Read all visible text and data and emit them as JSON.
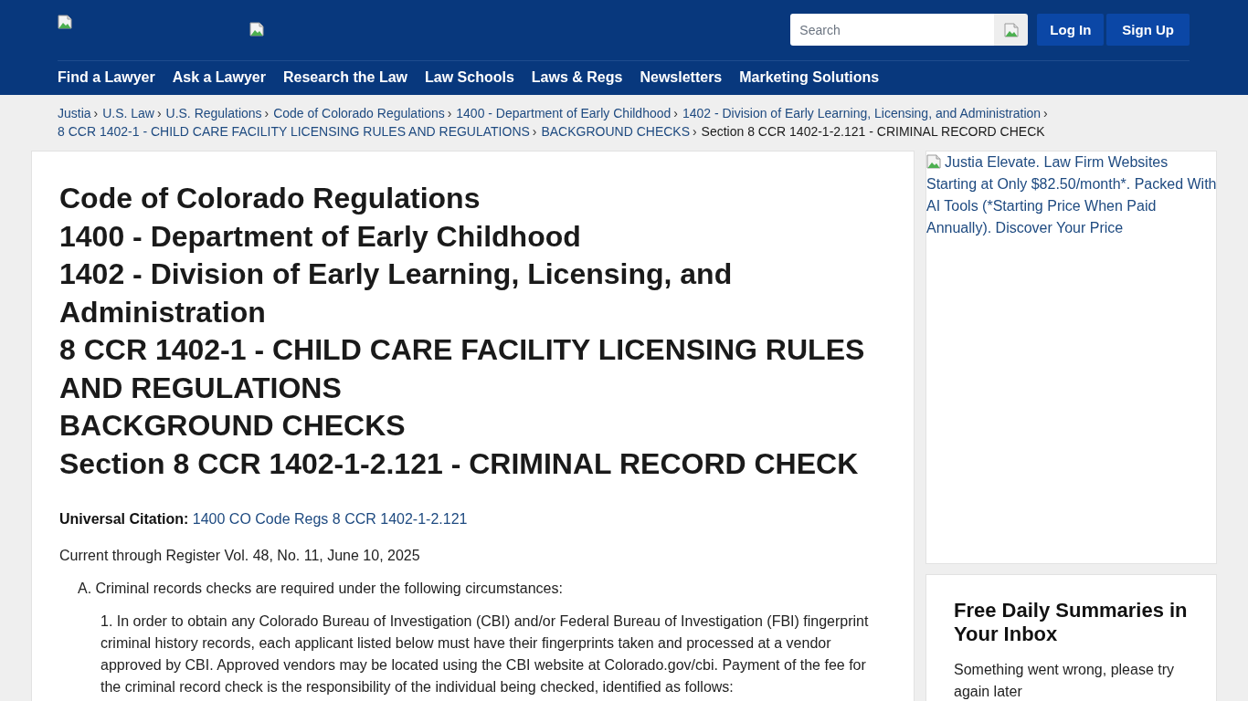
{
  "header": {
    "search": {
      "placeholder": "Search"
    },
    "buttons": [
      "Log In",
      "Sign Up"
    ],
    "nav": [
      "Find a Lawyer",
      "Ask a Lawyer",
      "Research the Law",
      "Law Schools",
      "Laws & Regs",
      "Newsletters",
      "Marketing Solutions"
    ]
  },
  "breadcrumbs": [
    {
      "label": "Justia",
      "current": false,
      "separator": "›"
    },
    {
      "label": "U.S. Law",
      "current": false,
      "separator": "›"
    },
    {
      "label": "U.S. Regulations",
      "current": false,
      "separator": "›"
    },
    {
      "label": "Code of Colorado Regulations",
      "current": false,
      "separator": "›"
    },
    {
      "label": "1400 - Department of Early Childhood",
      "current": false,
      "separator": "›"
    },
    {
      "label": "1402 - Division of Early Learning, Licensing, and Administration",
      "current": false,
      "separator": "›"
    },
    {
      "label": "8 CCR 1402-1 - CHILD CARE FACILITY LICENSING RULES AND REGULATIONS",
      "current": false,
      "separator": "›"
    },
    {
      "label": "BACKGROUND CHECKS",
      "current": false,
      "separator": "›"
    },
    {
      "label": "Section 8 CCR 1402-1-2.121 - CRIMINAL RECORD CHECK",
      "current": true
    }
  ],
  "main": {
    "title_lines": [
      "Code of Colorado Regulations",
      "1400 - Department of Early Childhood",
      "1402 - Division of Early Learning, Licensing, and Administration",
      "8 CCR 1402-1 - CHILD CARE FACILITY LICENSING RULES AND REGULATIONS",
      "BACKGROUND CHECKS",
      "Section 8 CCR 1402-1-2.121 - CRIMINAL RECORD CHECK"
    ],
    "citation": {
      "label": "Universal Citation:",
      "value": "1400 CO Code Regs 8 CCR 1402-1-2.121"
    },
    "currency": "Current through Register Vol. 48, No. 11, June 10, 2025",
    "sections": [
      {
        "text": "A. Criminal records checks are required under the following circumstances:",
        "children": [
          {
            "text": "1. In order to obtain any Colorado Bureau of Investigation (CBI) and/or Federal Bureau of Investigation (FBI) fingerprint criminal history records, each applicant listed below must have their fingerprints taken and processed at a vendor approved by CBI. Approved vendors may be located using the CBI website at Colorado.gov/cbi. Payment of the fee for the criminal record check is the responsibility of the individual being checked, identified as follows:"
          }
        ]
      }
    ]
  },
  "sidebar": {
    "ad": {
      "alt_text": "Justia Elevate. Law Firm Websites Starting at Only $82.50/month*. Packed With AI Tools (*Starting Price When Paid Annually). Discover Your Price"
    },
    "newsletter": {
      "title": "Free Daily Summaries in Your Inbox",
      "message": "Something went wrong, please try again later"
    }
  }
}
